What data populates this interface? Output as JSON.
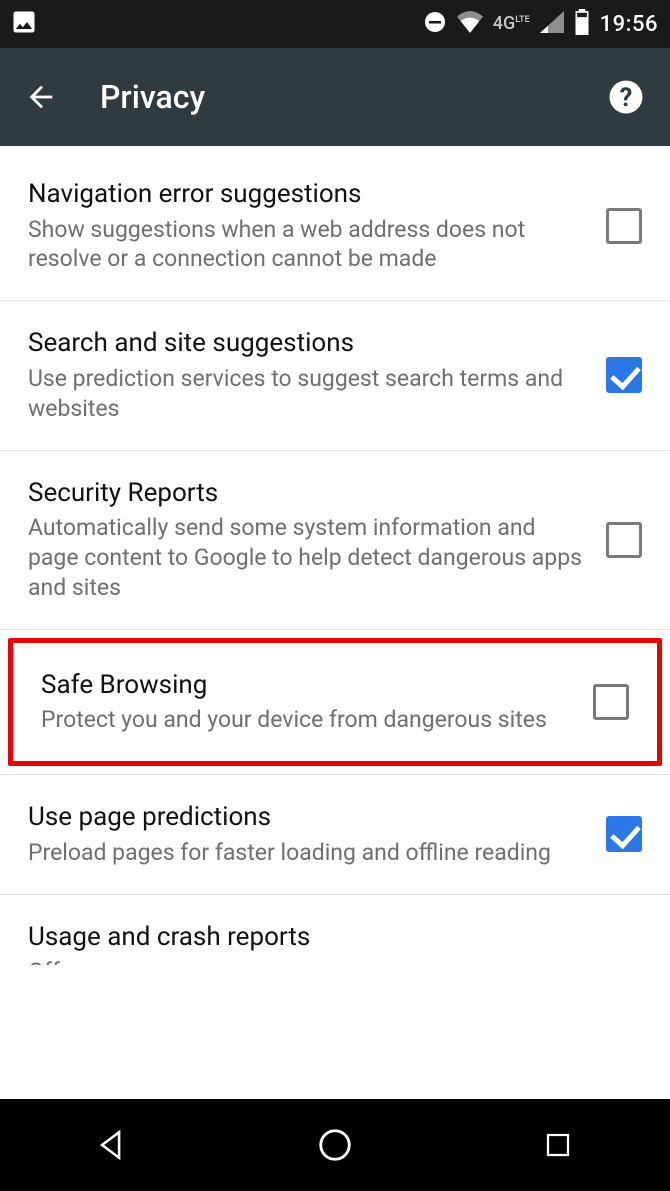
{
  "statusbar": {
    "network_label": "4G",
    "network_label_sub": "LTE",
    "time": "19:56"
  },
  "appbar": {
    "title": "Privacy"
  },
  "settings": [
    {
      "title": "Navigation error suggestions",
      "subtitle": "Show suggestions when a web address does not resolve or a connection cannot be made",
      "checked": false,
      "highlighted": false
    },
    {
      "title": "Search and site suggestions",
      "subtitle": "Use prediction services to suggest search terms and websites",
      "checked": true,
      "highlighted": false
    },
    {
      "title": "Security Reports",
      "subtitle": "Automatically send some system information and page content to Google to help detect dangerous apps and sites",
      "checked": false,
      "highlighted": false
    },
    {
      "title": "Safe Browsing",
      "subtitle": "Protect you and your device from dangerous sites",
      "checked": false,
      "highlighted": true
    },
    {
      "title": "Use page predictions",
      "subtitle": "Preload pages for faster loading and offline reading",
      "checked": true,
      "highlighted": false
    },
    {
      "title": "Usage and crash reports",
      "subtitle": "Off",
      "checked": null,
      "highlighted": false
    }
  ]
}
